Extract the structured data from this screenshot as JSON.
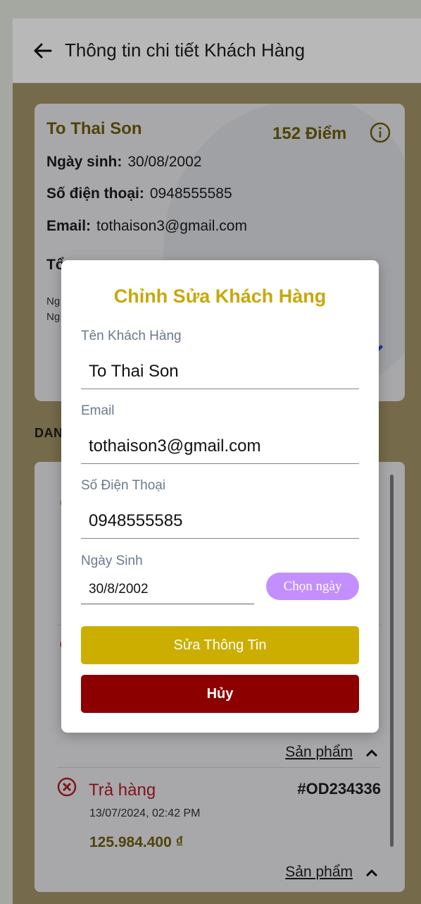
{
  "appbar": {
    "title": "Thông tin chi tiết Khách Hàng",
    "back_icon": "arrow-left-icon"
  },
  "customer": {
    "name": "To Thai Son",
    "points": "152 Điểm",
    "birth_label": "Ngày sinh:",
    "birth_value": "30/08/2002",
    "phone_label": "Số điện thoại:",
    "phone_value": "0948555585",
    "email_label": "Email:",
    "email_value": "tothaison3@gmail.com",
    "total_prefix": "Tổ",
    "small_line_1": "Ng",
    "small_line_2": "Ng"
  },
  "section_title": "DAN",
  "orders": [
    {
      "status": "Trả hàng",
      "code": "#OD234336",
      "date": "13/07/2024, 02:42 PM",
      "amount": "125.984.400 ₫",
      "products_label": "Sản phẩm"
    },
    {
      "products_label": "Sản phẩm"
    }
  ],
  "dialog": {
    "title": "Chỉnh Sửa Khách Hàng",
    "name_label": "Tên Khách Hàng",
    "name_value": "To Thai Son",
    "email_label": "Email",
    "email_value": "tothaison3@gmail.com",
    "phone_label": "Số Điện Thoại",
    "phone_value": "0948555585",
    "birth_label": "Ngày Sinh",
    "birth_value": "30/8/2002",
    "pick_date_label": "Chọn ngày",
    "save_label": "Sửa Thông Tin",
    "cancel_label": "Hủy"
  },
  "colors": {
    "page_bg": "#a29466",
    "gold": "#c9a707",
    "save_button": "#ccae00",
    "cancel_button": "#8c0000",
    "pick_date_button": "#c38fff",
    "status_red": "#b21d24"
  }
}
